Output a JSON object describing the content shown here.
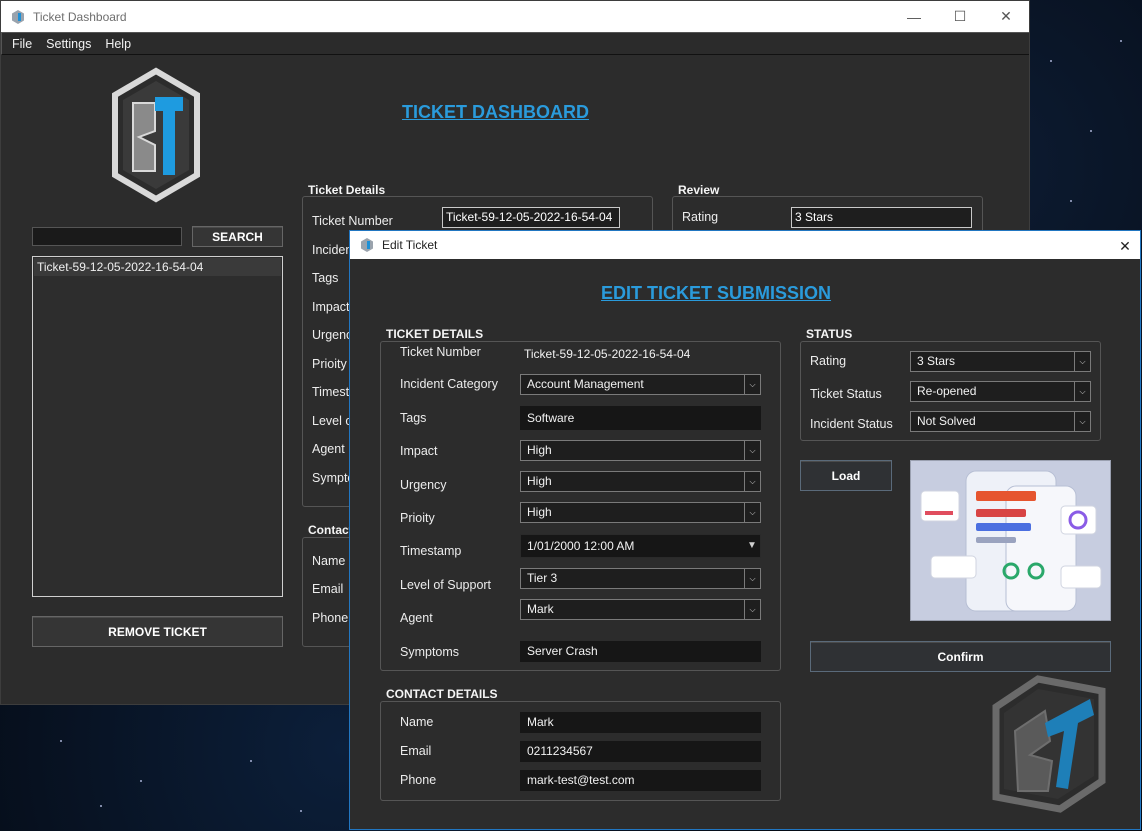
{
  "main_window": {
    "title": "Ticket Dashboard",
    "menu": [
      "File",
      "Settings",
      "Help"
    ],
    "heading": "TICKET DASHBOARD",
    "search_button": "SEARCH",
    "search_value": "",
    "tickets": [
      "Ticket-59-12-05-2022-16-54-04"
    ],
    "remove_button": "REMOVE TICKET",
    "ticket_details": {
      "title": "Ticket Details",
      "labels": [
        "Ticket Number",
        "Inciden",
        "Tags",
        "Impact",
        "Urgenc",
        "Prioity",
        "Timesta",
        "Level of",
        "Agent",
        "Sympto"
      ],
      "ticket_number": "Ticket-59-12-05-2022-16-54-04"
    },
    "review": {
      "title": "Review",
      "rating_label": "Rating",
      "rating_value": "3 Stars"
    },
    "contact": {
      "title": "Contact",
      "labels": [
        "Name",
        "Email",
        "Phone"
      ]
    }
  },
  "edit_window": {
    "title": "Edit Ticket",
    "heading": "EDIT TICKET SUBMISSION",
    "ticket_details": {
      "title": "TICKET DETAILS",
      "ticket_number_label": "Ticket Number",
      "ticket_number_value": "Ticket-59-12-05-2022-16-54-04",
      "incident_category_label": "Incident Category",
      "incident_category_value": "Account Management",
      "tags_label": "Tags",
      "tags_value": "Software",
      "impact_label": "Impact",
      "impact_value": "High",
      "urgency_label": "Urgency",
      "urgency_value": "High",
      "priority_label": "Prioity",
      "priority_value": "High",
      "timestamp_label": "Timestamp",
      "timestamp_value": "1/01/2000 12:00 AM",
      "level_label": "Level of Support",
      "level_value": "Tier 3",
      "agent_label": "Agent",
      "agent_value": "Mark",
      "symptoms_label": "Symptoms",
      "symptoms_value": "Server Crash"
    },
    "contact_details": {
      "title": "CONTACT DETAILS",
      "name_label": "Name",
      "name_value": "Mark",
      "email_label": "Email",
      "email_value": "0211234567",
      "phone_label": "Phone",
      "phone_value": "mark-test@test.com"
    },
    "status": {
      "title": "STATUS",
      "rating_label": "Rating",
      "rating_value": "3 Stars",
      "ticket_status_label": "Ticket Status",
      "ticket_status_value": "Re-opened",
      "incident_status_label": "Incident Status",
      "incident_status_value": "Not Solved"
    },
    "load_button": "Load",
    "confirm_button": "Confirm"
  },
  "colors": {
    "accent": "#2a9bdc",
    "window_bg": "#2c2c2c",
    "field_bg": "#1e1e1e"
  }
}
